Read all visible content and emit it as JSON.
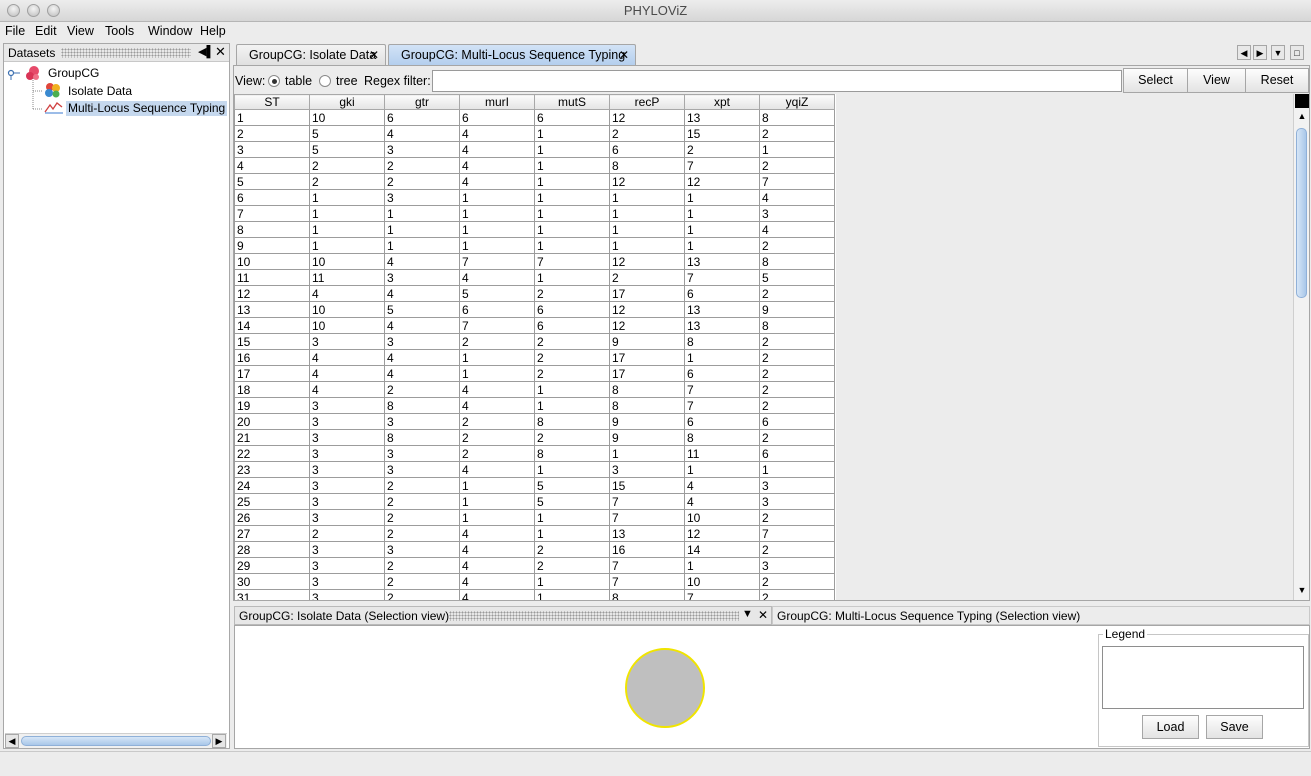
{
  "window": {
    "title": "PHYLOViZ"
  },
  "menu": [
    "File",
    "Edit",
    "View",
    "Tools",
    "Window",
    "Help"
  ],
  "datasets_panel": {
    "title": "Datasets",
    "root": "GroupCG",
    "children": [
      "Isolate Data",
      "Multi-Locus Sequence Typing"
    ]
  },
  "tabs": [
    {
      "label": "GroupCG: Isolate Data",
      "active": false
    },
    {
      "label": "GroupCG: Multi-Locus Sequence Typing",
      "active": true
    }
  ],
  "toolbar": {
    "view_label": "View:",
    "radio_table": "table",
    "radio_tree": "tree",
    "selected_view": "table",
    "regex_label": "Regex filter:",
    "regex_value": "",
    "select_btn": "Select",
    "view_btn": "View",
    "reset_btn": "Reset"
  },
  "table": {
    "columns": [
      "ST",
      "gki",
      "gtr",
      "murI",
      "mutS",
      "recP",
      "xpt",
      "yqiZ"
    ],
    "rows": [
      [
        "1",
        "10",
        "6",
        "6",
        "6",
        "12",
        "13",
        "8"
      ],
      [
        "2",
        "5",
        "4",
        "4",
        "1",
        "2",
        "15",
        "2"
      ],
      [
        "3",
        "5",
        "3",
        "4",
        "1",
        "6",
        "2",
        "1"
      ],
      [
        "4",
        "2",
        "2",
        "4",
        "1",
        "8",
        "7",
        "2"
      ],
      [
        "5",
        "2",
        "2",
        "4",
        "1",
        "12",
        "12",
        "7"
      ],
      [
        "6",
        "1",
        "3",
        "1",
        "1",
        "1",
        "1",
        "4"
      ],
      [
        "7",
        "1",
        "1",
        "1",
        "1",
        "1",
        "1",
        "3"
      ],
      [
        "8",
        "1",
        "1",
        "1",
        "1",
        "1",
        "1",
        "4"
      ],
      [
        "9",
        "1",
        "1",
        "1",
        "1",
        "1",
        "1",
        "2"
      ],
      [
        "10",
        "10",
        "4",
        "7",
        "7",
        "12",
        "13",
        "8"
      ],
      [
        "11",
        "11",
        "3",
        "4",
        "1",
        "2",
        "7",
        "5"
      ],
      [
        "12",
        "4",
        "4",
        "5",
        "2",
        "17",
        "6",
        "2"
      ],
      [
        "13",
        "10",
        "5",
        "6",
        "6",
        "12",
        "13",
        "9"
      ],
      [
        "14",
        "10",
        "4",
        "7",
        "6",
        "12",
        "13",
        "8"
      ],
      [
        "15",
        "3",
        "3",
        "2",
        "2",
        "9",
        "8",
        "2"
      ],
      [
        "16",
        "4",
        "4",
        "1",
        "2",
        "17",
        "1",
        "2"
      ],
      [
        "17",
        "4",
        "4",
        "1",
        "2",
        "17",
        "6",
        "2"
      ],
      [
        "18",
        "4",
        "2",
        "4",
        "1",
        "8",
        "7",
        "2"
      ],
      [
        "19",
        "3",
        "8",
        "4",
        "1",
        "8",
        "7",
        "2"
      ],
      [
        "20",
        "3",
        "3",
        "2",
        "8",
        "9",
        "6",
        "6"
      ],
      [
        "21",
        "3",
        "8",
        "2",
        "2",
        "9",
        "8",
        "2"
      ],
      [
        "22",
        "3",
        "3",
        "2",
        "8",
        "1",
        "11",
        "6"
      ],
      [
        "23",
        "3",
        "3",
        "4",
        "1",
        "3",
        "1",
        "1"
      ],
      [
        "24",
        "3",
        "2",
        "1",
        "5",
        "15",
        "4",
        "3"
      ],
      [
        "25",
        "3",
        "2",
        "1",
        "5",
        "7",
        "4",
        "3"
      ],
      [
        "26",
        "3",
        "2",
        "1",
        "1",
        "7",
        "10",
        "2"
      ],
      [
        "27",
        "2",
        "2",
        "4",
        "1",
        "13",
        "12",
        "7"
      ],
      [
        "28",
        "3",
        "3",
        "4",
        "2",
        "16",
        "14",
        "2"
      ],
      [
        "29",
        "3",
        "2",
        "4",
        "2",
        "7",
        "1",
        "3"
      ],
      [
        "30",
        "3",
        "2",
        "4",
        "1",
        "7",
        "10",
        "2"
      ],
      [
        "31",
        "3",
        "2",
        "4",
        "1",
        "8",
        "7",
        "2"
      ]
    ]
  },
  "bottom": {
    "left_tab": "GroupCG: Isolate Data (Selection view)",
    "right_tab": "GroupCG: Multi-Locus Sequence Typing (Selection view)",
    "legend_title": "Legend",
    "load_btn": "Load",
    "save_btn": "Save",
    "node_color": "#bfbfbf",
    "node_border_color": "#f0e400"
  },
  "colors": {
    "selected_highlight": "#c5d8ee",
    "active_tab": "#c4d9f2"
  }
}
